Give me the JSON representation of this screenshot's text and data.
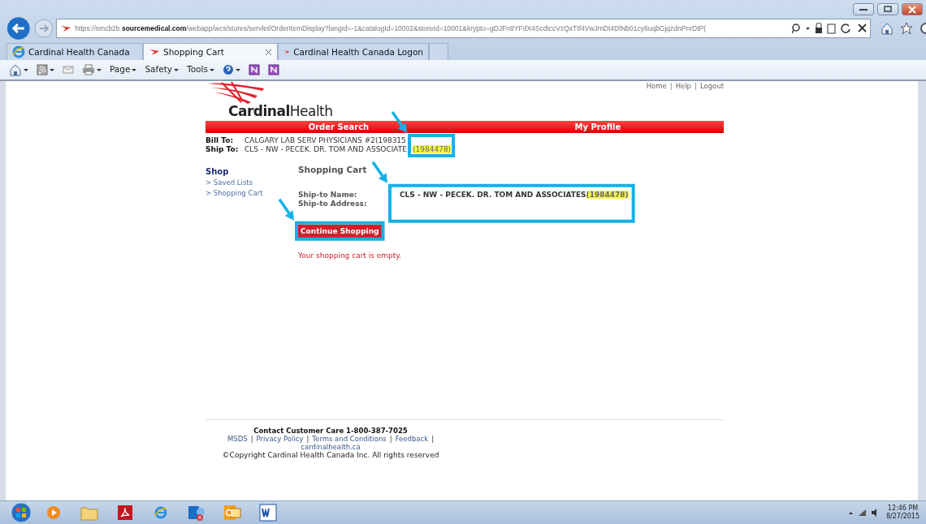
{
  "browser": {
    "url": "https://smcb2b.**sourcemedical.com**/webapp/wcs/stores/servlet/OrderItemDisplay?langId=-1&catalogId=10002&storeId=10001&krypto=gDJFn8YFdX4ScdtccVzQxTtf4VwJmDt4DlNb01cy6uqbGjqzdnPnrDtP(",
    "tabs": [
      {
        "label": "Cardinal Health Canada",
        "selected": false,
        "kind": "ie"
      },
      {
        "label": "Shopping Cart",
        "selected": true,
        "kind": "cardinal"
      },
      {
        "label": "Cardinal Health Canada Logon",
        "selected": false,
        "kind": "cardinal"
      }
    ],
    "command_bar": [
      {
        "kind": "home",
        "dropdown": true
      },
      {
        "kind": "feeds",
        "dropdown": true
      },
      {
        "kind": "mail",
        "dropdown": false
      },
      {
        "kind": "print",
        "dropdown": true
      },
      {
        "kind": "menu",
        "label": "Page",
        "dropdown": true
      },
      {
        "kind": "menu",
        "label": "Safety",
        "dropdown": true
      },
      {
        "kind": "menu",
        "label": "Tools",
        "dropdown": true
      },
      {
        "kind": "help",
        "dropdown": true
      },
      {
        "kind": "onenote",
        "dropdown": false
      },
      {
        "kind": "onenote",
        "dropdown": false
      }
    ]
  },
  "page": {
    "header_links": [
      "Home",
      "Help",
      "Logout"
    ],
    "separator": "|",
    "logo": "**Cardinal**Health",
    "nav": [
      "Order Search",
      "My Profile"
    ],
    "bill_to": {
      "label": "Bill To:",
      "segments": [
        {
          "text": "CALGARY LAB SERV PHYSICIANS #2(198315",
          "highlighted": false
        }
      ]
    },
    "ship_to": {
      "label": "Ship To:",
      "segments": [
        {
          "text": "CLS - NW - PECEK. DR. TOM AND ASSOCIATE",
          "highlighted": false
        },
        {
          "text": "(1984478)",
          "highlighted": true
        }
      ]
    },
    "sidebar": {
      "heading": "Shop",
      "items": [
        "> Saved Lists",
        "> Shopping Cart"
      ]
    },
    "main": {
      "heading": "Shopping Cart",
      "fields": [
        {
          "label": "Ship-to Name:",
          "segments": [
            {
              "text": "CLS - NW - PECEK. DR. TOM AND ASSOCIATES",
              "highlighted": false
            },
            {
              "text": "(1984478)",
              "highlighted": true
            }
          ]
        },
        {
          "label": "Ship-to Address:"
        }
      ],
      "button": "Continue Shopping",
      "message": "Your shopping cart is empty."
    },
    "footer": {
      "contact": "Contact Customer Care 1-800-387-7025",
      "links": [
        "MSDS",
        "Privacy Policy",
        "Terms and Conditions",
        "Feedback"
      ],
      "separator": "|",
      "site": "cardinalhealth.ca",
      "copyright": "©Copyright Cardinal Health Canada Inc. All rights reserved"
    }
  },
  "taskbar": {
    "apps": [
      {
        "kind": "media"
      },
      {
        "kind": "folder"
      },
      {
        "kind": "pdf"
      },
      {
        "kind": "ie"
      },
      {
        "kind": "lync"
      },
      {
        "kind": "outlook"
      },
      {
        "kind": "word"
      }
    ],
    "time": "12:46 PM",
    "date": "8/27/2015"
  }
}
